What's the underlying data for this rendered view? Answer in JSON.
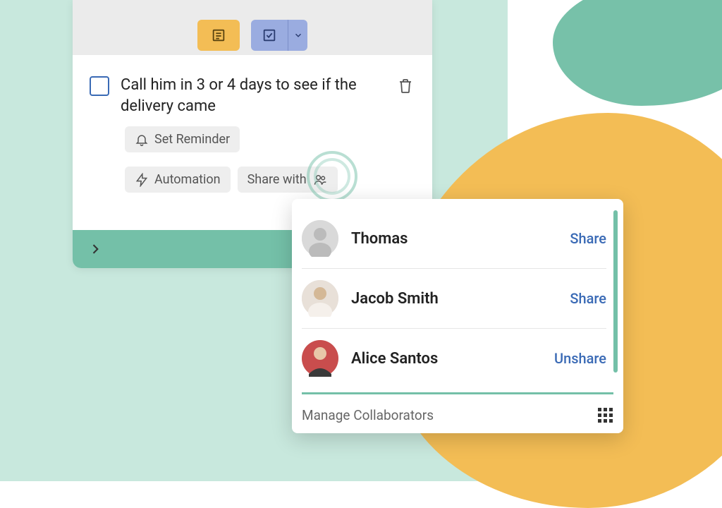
{
  "task": {
    "text": "Call him in 3 or 4 days to see if the delivery came"
  },
  "actions": {
    "reminder": "Set Reminder",
    "automation": "Automation",
    "share": "Share with"
  },
  "popup": {
    "contacts": [
      {
        "name": "Thomas",
        "action": "Share"
      },
      {
        "name": "Jacob Smith",
        "action": "Share"
      },
      {
        "name": "Alice Santos",
        "action": "Unshare"
      }
    ],
    "footer": "Manage Collaborators"
  },
  "colors": {
    "mint": "#c8e8dd",
    "teal": "#74c0a8",
    "orange": "#f3bd55",
    "blue": "#9aace0",
    "link": "#3a6ab5"
  }
}
